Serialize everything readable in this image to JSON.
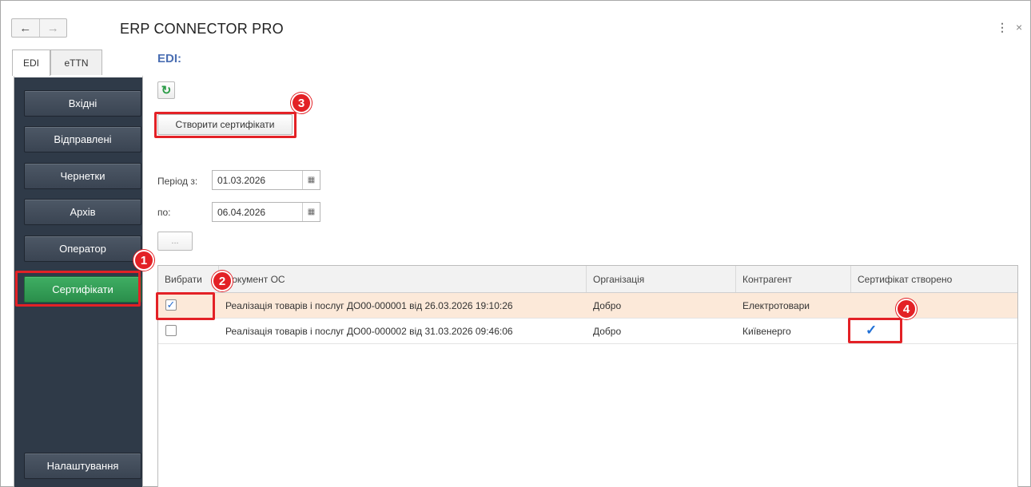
{
  "window": {
    "title": "ERP CONNECTOR PRO",
    "back_icon": "←",
    "forward_icon": "→",
    "more_icon": "⋮",
    "close_icon": "×"
  },
  "tabs": [
    {
      "label": "EDI",
      "active": true
    },
    {
      "label": "eTTN",
      "active": false
    }
  ],
  "sidebar": {
    "items": [
      {
        "label": "Вхідні"
      },
      {
        "label": "Відправлені"
      },
      {
        "label": "Чернетки"
      },
      {
        "label": "Архів"
      },
      {
        "label": "Оператор"
      },
      {
        "label": "Сертифікати",
        "active": true
      }
    ],
    "settings_label": "Налаштування"
  },
  "main": {
    "title": "EDI:",
    "refresh_icon": "refresh-icon",
    "create_button_label": "Створити сертифікати",
    "period_from_label": "Період з:",
    "period_from_value": "01.03.2026",
    "period_to_label": "по:",
    "period_to_value": "06.04.2026",
    "dots_label": "...",
    "table": {
      "columns": [
        "Вибрати",
        "Документ ОС",
        "Організація",
        "Контрагент",
        "Сертифікат створено"
      ],
      "rows": [
        {
          "selected": true,
          "document": "Реалізація товарів і послуг ДО00-000001 від 26.03.2026 19:10:26",
          "organization": "Добро",
          "counterparty": "Електротовари",
          "certificate_created": false
        },
        {
          "selected": false,
          "document": "Реалізація товарів і послуг ДО00-000002 від 31.03.2026 09:46:06",
          "organization": "Добро",
          "counterparty": "Київенерго",
          "certificate_created": true
        }
      ]
    }
  },
  "annotations": {
    "badges": [
      "1",
      "2",
      "3",
      "4"
    ],
    "highlight_color": "#e32126"
  },
  "colors": {
    "sidebar_bg": "#2f3a48",
    "active_green": "#2a8e4b",
    "title_blue": "#4b6fb3",
    "selected_row": "#fce9d9"
  }
}
